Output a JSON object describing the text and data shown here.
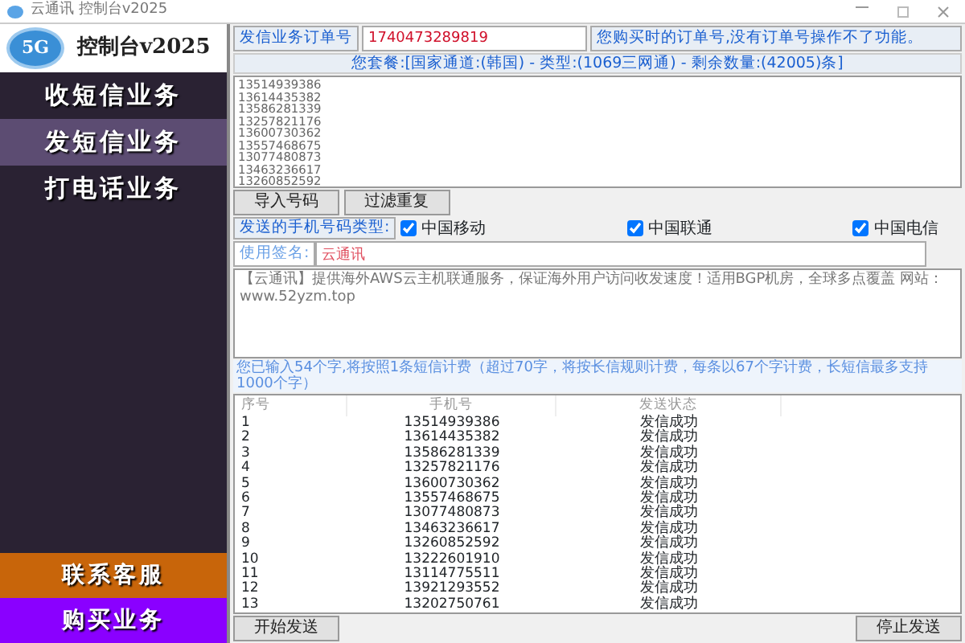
{
  "window": {
    "title": "云通讯 控制台v2025"
  },
  "logo": {
    "badge": "5G",
    "title": "控制台v2025"
  },
  "sidebar": {
    "items": [
      {
        "label": "收短信业务",
        "selected": false
      },
      {
        "label": "发短信业务",
        "selected": true
      },
      {
        "label": "打电话业务",
        "selected": false
      }
    ],
    "footer_items": [
      {
        "label": "联系客服",
        "color": "#c8650a"
      },
      {
        "label": "购买业务",
        "color": "#8a00ff"
      }
    ]
  },
  "order": {
    "label": "发信业务订单号",
    "value": "1740473289819",
    "note": "您购买时的订单号,没有订单号操作不了功能。"
  },
  "package": "您套餐:[国家通道:(韩国) - 类型:(1069三网通) - 剩余数量:(42005)条]",
  "numbers": [
    "13514939386",
    "13614435382",
    "13586281339",
    "13257821176",
    "13600730362",
    "13557468675",
    "13077480873",
    "13463236617",
    "13260852592"
  ],
  "number_buttons": [
    "导入号码",
    "过滤重复"
  ],
  "carrier": {
    "label": "发送的手机号码类型:",
    "options": [
      {
        "label": "中国移动",
        "checked": true
      },
      {
        "label": "中国联通",
        "checked": true
      },
      {
        "label": "中国电信",
        "checked": true
      }
    ]
  },
  "signature": {
    "label": "使用签名:",
    "value": "云通讯"
  },
  "message": "【云通讯】提供海外AWS云主机联通服务，保证海外用户访问收发速度！适用BGP机房，全球多点覆盖 网站：www.52yzm.top",
  "hint": "您已输入54个字,将按照1条短信计费（超过70字，将按长信规则计费，每条以67个字计费，长短信最多支持1000个字）",
  "table": {
    "columns": [
      "序号",
      "手机号",
      "发送状态"
    ],
    "rows": [
      [
        "1",
        "13514939386",
        "发信成功"
      ],
      [
        "2",
        "13614435382",
        "发信成功"
      ],
      [
        "3",
        "13586281339",
        "发信成功"
      ],
      [
        "4",
        "13257821176",
        "发信成功"
      ],
      [
        "5",
        "13600730362",
        "发信成功"
      ],
      [
        "6",
        "13557468675",
        "发信成功"
      ],
      [
        "7",
        "13077480873",
        "发信成功"
      ],
      [
        "8",
        "13463236617",
        "发信成功"
      ],
      [
        "9",
        "13260852592",
        "发信成功"
      ],
      [
        "10",
        "13222601910",
        "发信成功"
      ],
      [
        "11",
        "13114775511",
        "发信成功"
      ],
      [
        "12",
        "13921293552",
        "发信成功"
      ],
      [
        "13",
        "13202750761",
        "发信成功"
      ]
    ]
  },
  "actions": {
    "start": "开始发送",
    "stop": "停止发送"
  }
}
